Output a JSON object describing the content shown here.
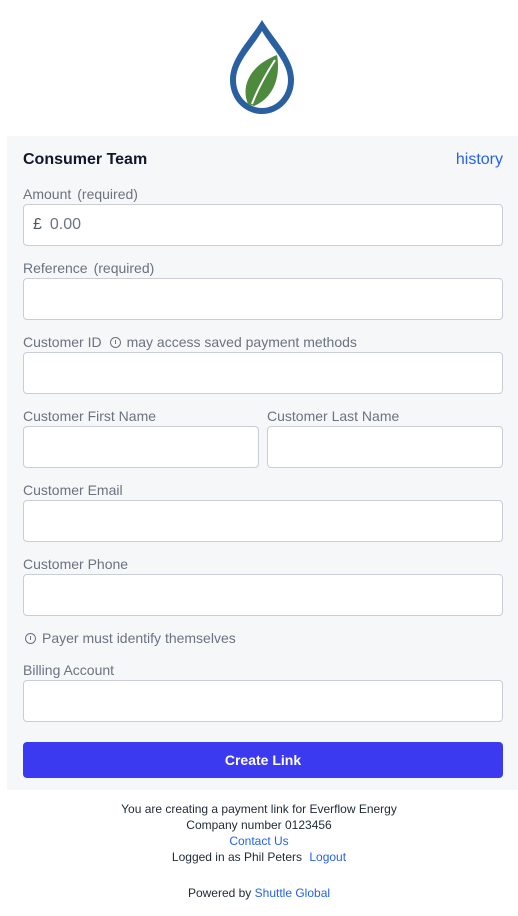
{
  "header": {
    "team": "Consumer Team",
    "history_link": "history"
  },
  "form": {
    "amount": {
      "label": "Amount",
      "required": "(required)",
      "currency_symbol": "£",
      "placeholder": "0.00",
      "value": ""
    },
    "reference": {
      "label": "Reference",
      "required": "(required)",
      "value": ""
    },
    "customer_id": {
      "label": "Customer ID",
      "hint": "may access saved payment methods",
      "value": ""
    },
    "first_name": {
      "label": "Customer First Name",
      "value": ""
    },
    "last_name": {
      "label": "Customer Last Name",
      "value": ""
    },
    "email": {
      "label": "Customer Email",
      "value": ""
    },
    "phone": {
      "label": "Customer Phone",
      "value": ""
    },
    "payer_note": "Payer must identify themselves",
    "billing_account": {
      "label": "Billing Account",
      "value": ""
    },
    "submit_label": "Create Link"
  },
  "footer": {
    "line1": "You are creating a payment link for Everflow Energy",
    "line2": "Company number 0123456",
    "contact": "Contact Us",
    "logged_in": "Logged in as Phil Peters",
    "logout": "Logout",
    "powered_by": "Powered by",
    "powered_link": "Shuttle Global"
  },
  "colors": {
    "accent": "#3b3af0",
    "link": "#2563eb",
    "logo_blue": "#2a5fa0",
    "logo_green": "#4e8a3e"
  }
}
